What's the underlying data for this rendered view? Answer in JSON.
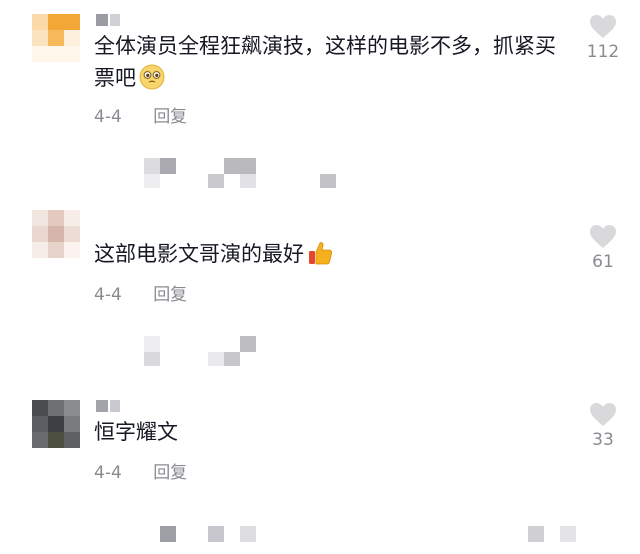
{
  "comments": [
    {
      "text": "全体演员全程狂飙演技，这样的电影不多，抓紧买票吧",
      "date": "4-4",
      "reply_label": "回复",
      "likes": "112",
      "emoji": "pleading-face-icon"
    },
    {
      "text": "这部电影文哥演的最好",
      "date": "4-4",
      "reply_label": "回复",
      "likes": "61",
      "emoji": "thumbs-up-icon"
    },
    {
      "text": "恒字耀文",
      "date": "4-4",
      "reply_label": "回复",
      "likes": "33"
    }
  ],
  "colors": {
    "text": "#161823",
    "meta": "#8a8b91",
    "heart": "#d9d9dc",
    "background": "#ffffff"
  }
}
